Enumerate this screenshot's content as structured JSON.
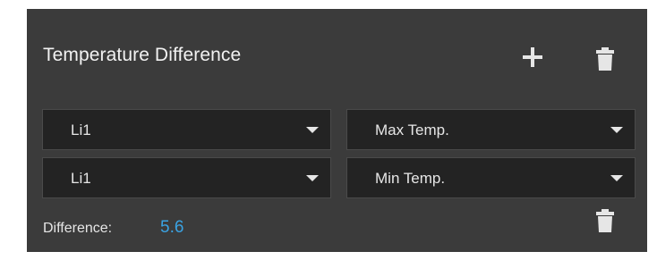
{
  "panel": {
    "title": "Temperature Difference"
  },
  "toolbar": {
    "add_icon": "plus-icon",
    "delete_icon": "trash-icon"
  },
  "rows": [
    {
      "source": "Li1",
      "metric": "Max Temp."
    },
    {
      "source": "Li1",
      "metric": "Min Temp."
    }
  ],
  "difference": {
    "label": "Difference:",
    "value": "5.6"
  },
  "colors": {
    "panel_bg": "#3b3b3b",
    "field_bg": "#232323",
    "accent_value": "#3aa3e3",
    "text": "#e6e6e6"
  }
}
